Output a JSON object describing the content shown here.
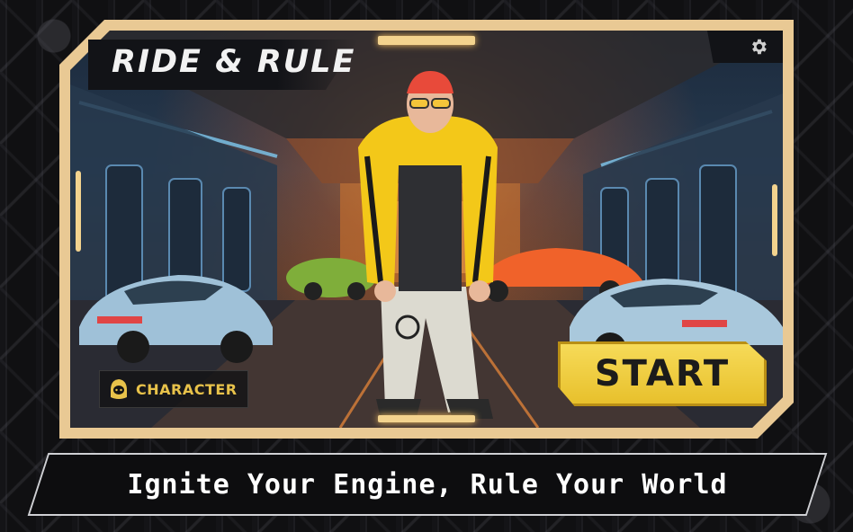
{
  "game": {
    "title": "RIDE & RULE",
    "tagline": "Ignite Your Engine, Rule Your World"
  },
  "buttons": {
    "start_label": "START",
    "character_label": "CHARACTER"
  },
  "icons": {
    "settings": "gear-icon",
    "character": "hooded-figure-icon"
  },
  "colors": {
    "frame": "#e9c994",
    "accent_yellow": "#f0cf44",
    "character_text": "#e8c24a"
  }
}
